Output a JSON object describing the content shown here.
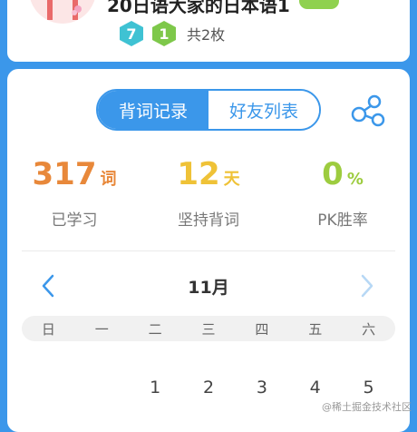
{
  "book": {
    "title": "20日语大家的日本语1",
    "badges": [
      {
        "value": "7",
        "color": "#3fc2d3"
      },
      {
        "value": "1",
        "color": "#7ec84a"
      }
    ],
    "badge_total": "共2枚"
  },
  "tabs": [
    {
      "label": "背词记录",
      "active": true
    },
    {
      "label": "好友列表",
      "active": false
    }
  ],
  "share_icon": "share-icon",
  "stats": [
    {
      "value": "317",
      "unit": "词",
      "label": "已学习",
      "color": "#e8883a"
    },
    {
      "value": "12",
      "unit": "天",
      "label": "坚持背词",
      "color": "#efc237"
    },
    {
      "value": "0",
      "unit": "%",
      "label": "PK胜率",
      "color": "#9dcc3f"
    }
  ],
  "calendar": {
    "month": "11月",
    "prev_icon": "chevron-left-icon",
    "next_icon": "chevron-right-icon",
    "weekdays": [
      "日",
      "一",
      "二",
      "三",
      "四",
      "五",
      "六"
    ],
    "first_row": [
      "",
      "",
      "1",
      "2",
      "3",
      "4",
      "5"
    ]
  },
  "watermark": "@稀土掘金技术社区",
  "colors": {
    "accent": "#3b97ea",
    "background": "#3b97ea"
  }
}
